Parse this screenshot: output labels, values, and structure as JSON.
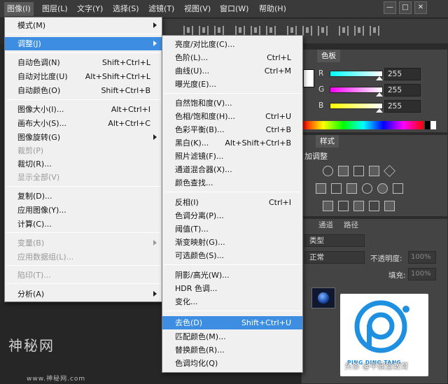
{
  "menubar": {
    "items": [
      "图像(I)",
      "图层(L)",
      "文字(Y)",
      "选择(S)",
      "滤镜(T)",
      "视图(V)",
      "窗口(W)",
      "帮助(H)"
    ],
    "window_controls": [
      "—",
      "□",
      "✕"
    ]
  },
  "image_menu": {
    "items": [
      {
        "label": "模式(M)",
        "submenu": true
      },
      {
        "label": "调整(J)",
        "submenu": true,
        "highlighted": true
      },
      {
        "label": "自动色调(N)",
        "shortcut": "Shift+Ctrl+L"
      },
      {
        "label": "自动对比度(U)",
        "shortcut": "Alt+Shift+Ctrl+L"
      },
      {
        "label": "自动颜色(O)",
        "shortcut": "Shift+Ctrl+B"
      },
      {
        "label": "图像大小(I)...",
        "shortcut": "Alt+Ctrl+I"
      },
      {
        "label": "画布大小(S)...",
        "shortcut": "Alt+Ctrl+C"
      },
      {
        "label": "图像旋转(G)",
        "submenu": true
      },
      {
        "label": "裁剪(P)",
        "disabled": true
      },
      {
        "label": "裁切(R)..."
      },
      {
        "label": "显示全部(V)",
        "disabled": true
      },
      {
        "label": "复制(D)..."
      },
      {
        "label": "应用图像(Y)..."
      },
      {
        "label": "计算(C)..."
      },
      {
        "label": "变量(B)",
        "submenu": true,
        "disabled": true
      },
      {
        "label": "应用数据组(L)...",
        "disabled": true
      },
      {
        "label": "陷印(T)...",
        "disabled": true
      },
      {
        "label": "分析(A)",
        "submenu": true
      }
    ]
  },
  "adjust_menu": {
    "items": [
      {
        "label": "亮度/对比度(C)..."
      },
      {
        "label": "色阶(L)...",
        "shortcut": "Ctrl+L"
      },
      {
        "label": "曲线(U)...",
        "shortcut": "Ctrl+M"
      },
      {
        "label": "曝光度(E)..."
      },
      {
        "label": "自然饱和度(V)..."
      },
      {
        "label": "色相/饱和度(H)...",
        "shortcut": "Ctrl+U"
      },
      {
        "label": "色彩平衡(B)...",
        "shortcut": "Ctrl+B"
      },
      {
        "label": "黑白(K)...",
        "shortcut": "Alt+Shift+Ctrl+B"
      },
      {
        "label": "照片滤镜(F)..."
      },
      {
        "label": "通道混合器(X)..."
      },
      {
        "label": "颜色查找..."
      },
      {
        "label": "反相(I)",
        "shortcut": "Ctrl+I"
      },
      {
        "label": "色调分离(P)..."
      },
      {
        "label": "阈值(T)..."
      },
      {
        "label": "渐变映射(G)..."
      },
      {
        "label": "可选颜色(S)..."
      },
      {
        "label": "阴影/高光(W)..."
      },
      {
        "label": "HDR 色调..."
      },
      {
        "label": "变化..."
      },
      {
        "label": "去色(D)",
        "shortcut": "Shift+Ctrl+U",
        "highlighted": true
      },
      {
        "label": "匹配颜色(M)..."
      },
      {
        "label": "替换颜色(R)..."
      },
      {
        "label": "色调均化(Q)"
      }
    ]
  },
  "color_panel": {
    "tabs": [
      "色板"
    ],
    "channels": [
      {
        "name": "R",
        "value": "255"
      },
      {
        "name": "G",
        "value": "255"
      },
      {
        "name": "B",
        "value": "255"
      }
    ]
  },
  "adjustments_panel": {
    "tab": "样式",
    "title": "加调整"
  },
  "layers_panel": {
    "tabs": [
      "通道",
      "路径"
    ],
    "kind_label": "类型",
    "blend_mode": "正常",
    "opacity_label": "不透明度:",
    "opacity_value": "100%",
    "fill_label": "填充:",
    "fill_value": "100%"
  },
  "watermarks": {
    "site_big": "神秘网",
    "site_small": "www.神秘网.com",
    "brand_text": "PING DING TANG",
    "caption": "头条 @平鼎堂教育"
  },
  "colors": {
    "highlight": "#3d8ee3",
    "menu_bg": "#f0f0f0",
    "logo_blue": "#1f8fe0"
  }
}
